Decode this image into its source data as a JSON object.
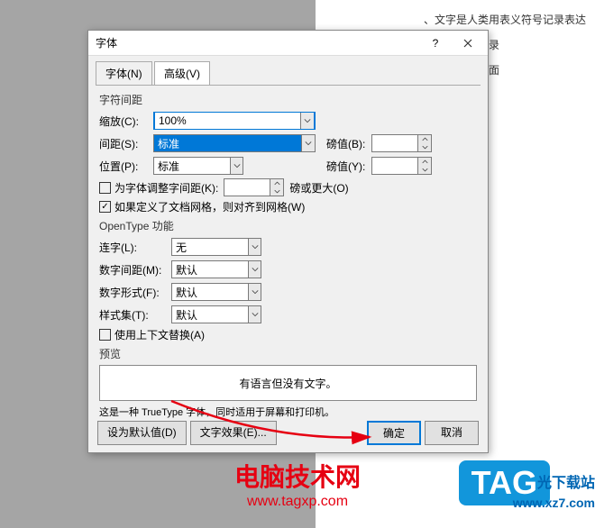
{
  "dialog": {
    "title": "字体",
    "tabs": {
      "font": "字体(N)",
      "advanced": "高级(V)"
    },
    "charSpacing": {
      "sectionLabel": "字符间距",
      "scale": {
        "label": "缩放(C):",
        "value": "100%"
      },
      "spacing": {
        "label": "间距(S):",
        "value": "标准",
        "pointLabel": "磅值(B):",
        "pointValue": ""
      },
      "position": {
        "label": "位置(P):",
        "value": "标准",
        "pointLabel": "磅值(Y):",
        "pointValue": ""
      },
      "kerning": {
        "label": "为字体调整字间距(K):",
        "value": "",
        "unit": "磅或更大(O)"
      },
      "grid": {
        "label": "如果定义了文档网格，则对齐到网格(W)"
      }
    },
    "opentype": {
      "sectionLabel": "OpenType 功能",
      "ligature": {
        "label": "连字(L):",
        "value": "无"
      },
      "numSpacing": {
        "label": "数字间距(M):",
        "value": "默认"
      },
      "numForm": {
        "label": "数字形式(F):",
        "value": "默认"
      },
      "styleSet": {
        "label": "样式集(T):",
        "value": "默认"
      },
      "contextual": {
        "label": "使用上下文替换(A)"
      }
    },
    "preview": {
      "label": "预览",
      "text": "有语言但没有文字。",
      "description": "这是一种 TrueType 字体，同时适用于屏幕和打印机。"
    },
    "buttons": {
      "setDefault": "设为默认值(D)",
      "textEffects": "文字效果(E)...",
      "ok": "确定",
      "cancel": "取消"
    }
  },
  "bgText": {
    "line1": "、文字是人类用表义符号记录表达",
    "line2": "代文字多是记录",
    "line3": "语言后产生书面"
  },
  "watermark": {
    "title": "电脑技术网",
    "url": "www.tagxp.com",
    "tag": "TAG",
    "dlText": "光下载站",
    "dlUrl": "www.xz7.com"
  }
}
